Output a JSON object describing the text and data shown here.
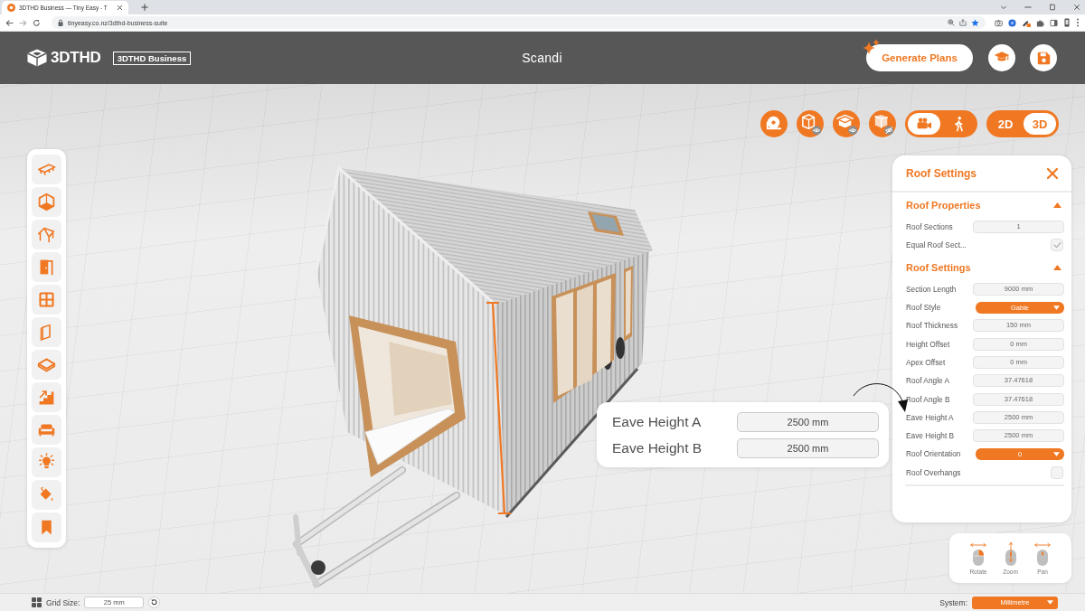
{
  "browser": {
    "tab_title": "3DTHD Business — Tiny Easy - T",
    "url": "tinyeasy.co.nz/3dthd-business-suite"
  },
  "header": {
    "logo": "3DTHD",
    "edition_badge": "3DTHD Business",
    "project_title": "Scandi",
    "generate_button": "Generate Plans"
  },
  "view_toolbar": {
    "camera_modes": [
      {
        "kind": "orbit",
        "selected": true
      },
      {
        "kind": "walk",
        "selected": false
      }
    ],
    "view_modes": [
      {
        "label": "2D",
        "selected": false
      },
      {
        "label": "3D",
        "selected": true
      }
    ]
  },
  "eave_popup": {
    "rows": [
      {
        "label": "Eave Height A",
        "value": "2500 mm"
      },
      {
        "label": "Eave Height B",
        "value": "2500 mm"
      }
    ]
  },
  "roof_panel": {
    "title": "Roof Settings",
    "sections": [
      {
        "title": "Roof Properties",
        "expanded": true,
        "rows": [
          {
            "kind": "field",
            "label": "Roof Sections",
            "value": "1"
          },
          {
            "kind": "checkbox",
            "label": "Equal Roof Sect...",
            "checked": true
          }
        ]
      },
      {
        "title": "Roof Settings",
        "expanded": true,
        "rows": [
          {
            "kind": "field",
            "label": "Section Length",
            "value": "9000 mm"
          },
          {
            "kind": "select",
            "label": "Roof Style",
            "value": "Gable"
          },
          {
            "kind": "field",
            "label": "Roof Thickness",
            "value": "150 mm"
          },
          {
            "kind": "field",
            "label": "Height Offset",
            "value": "0 mm"
          },
          {
            "kind": "field",
            "label": "Apex Offset",
            "value": "0 mm"
          },
          {
            "kind": "field",
            "label": "Roof Angle A",
            "value": "37.47618"
          },
          {
            "kind": "field",
            "label": "Roof Angle B",
            "value": "37.47618"
          },
          {
            "kind": "field",
            "label": "Eave Height A",
            "value": "2500 mm"
          },
          {
            "kind": "field",
            "label": "Eave Height B",
            "value": "2500 mm"
          },
          {
            "kind": "select",
            "label": "Roof Orientation",
            "value": "0"
          },
          {
            "kind": "checkbox",
            "label": "Roof Overhangs",
            "checked": false
          }
        ]
      }
    ]
  },
  "mouse_controls": [
    {
      "kind": "rotate",
      "label": "Rotate"
    },
    {
      "kind": "zoom",
      "label": "Zoom"
    },
    {
      "kind": "pan",
      "label": "Pan"
    }
  ],
  "status_bar": {
    "grid_size_label": "Grid Size:",
    "grid_size_value": "25 mm",
    "system_label": "System:",
    "system_value": "Millimetre"
  }
}
